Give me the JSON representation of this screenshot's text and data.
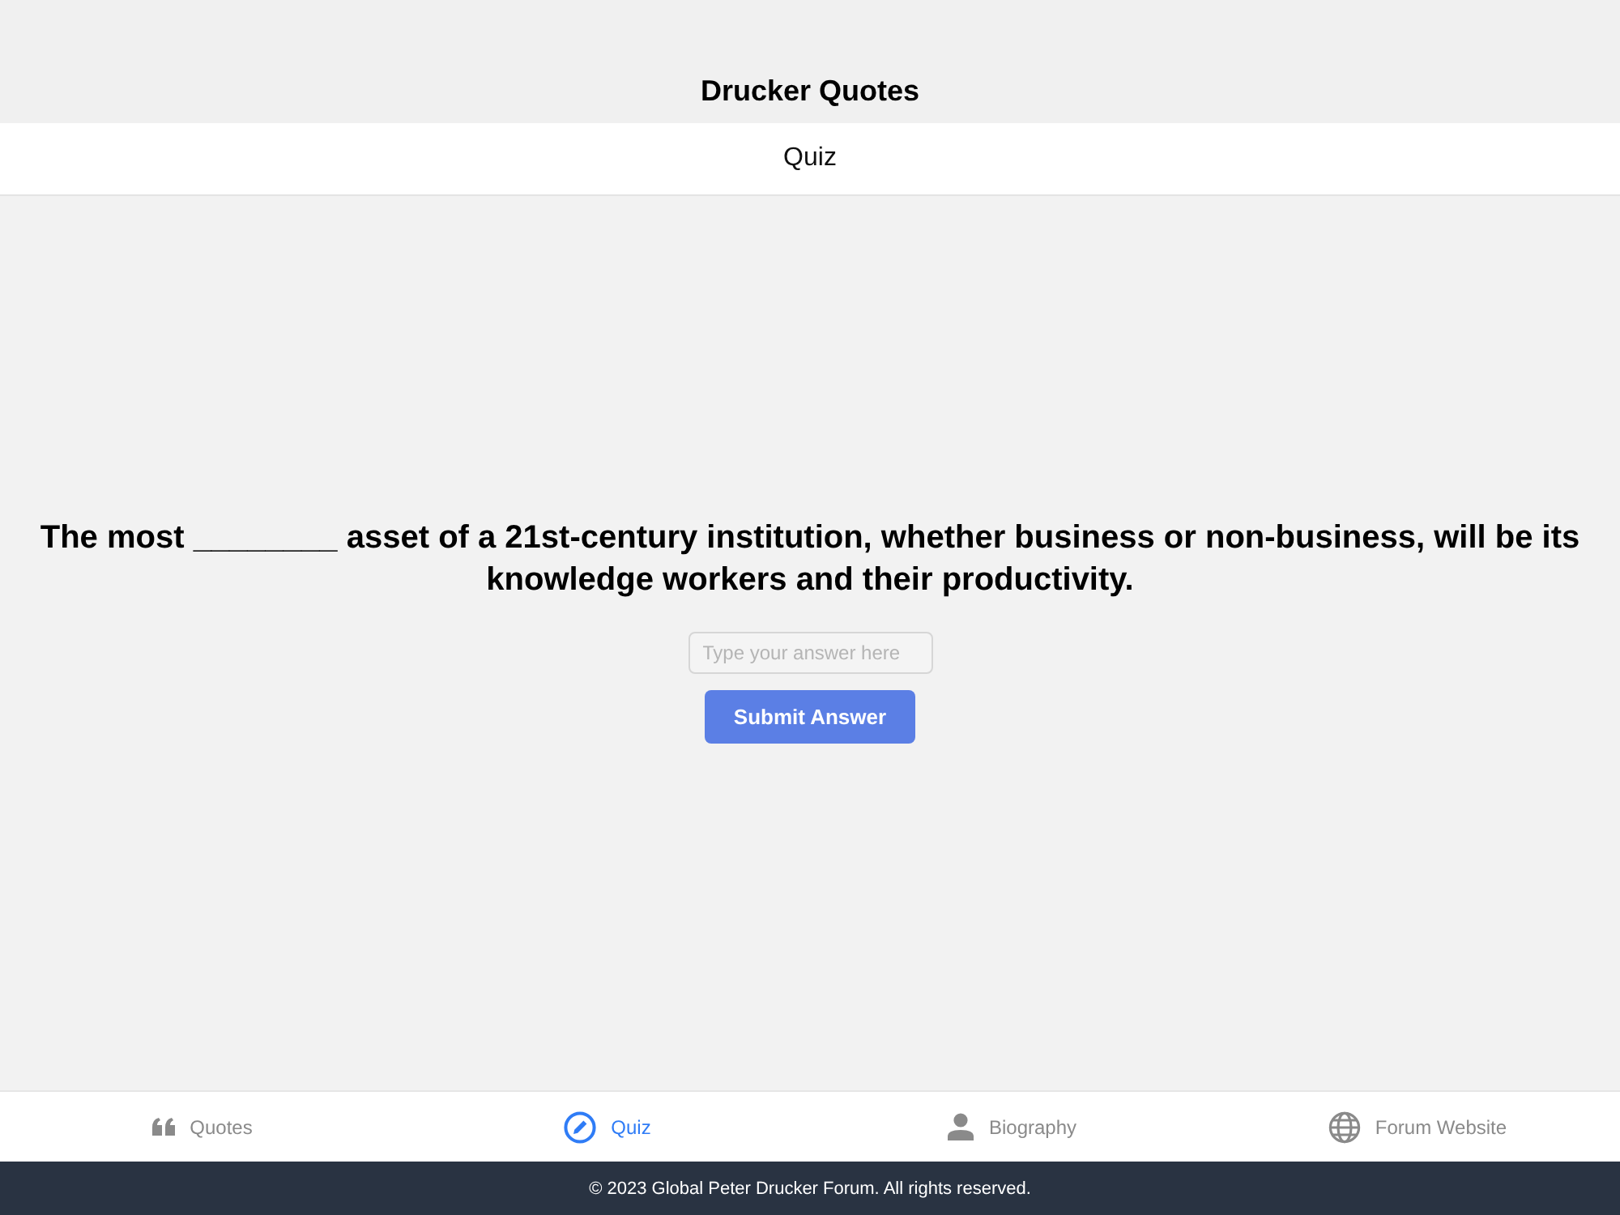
{
  "header": {
    "title": "Drucker Quotes"
  },
  "subheader": {
    "title": "Quiz"
  },
  "quiz": {
    "question": "The most ________ asset of a 21st-century institution, whether business or non-business, will be its knowledge workers and their productivity.",
    "answer_field": {
      "placeholder": "Type your answer here"
    },
    "submit_button": "Submit Answer"
  },
  "tab_bar": [
    {
      "label": "Quotes",
      "kind": "quotes",
      "selected": false
    },
    {
      "label": "Quiz",
      "kind": "quiz",
      "selected": true
    },
    {
      "label": "Biography",
      "kind": "biography",
      "selected": false
    },
    {
      "label": "Forum Website",
      "kind": "website",
      "selected": false
    }
  ],
  "footer": {
    "text": "© 2023 Global Peter Drucker Forum. All rights reserved."
  }
}
